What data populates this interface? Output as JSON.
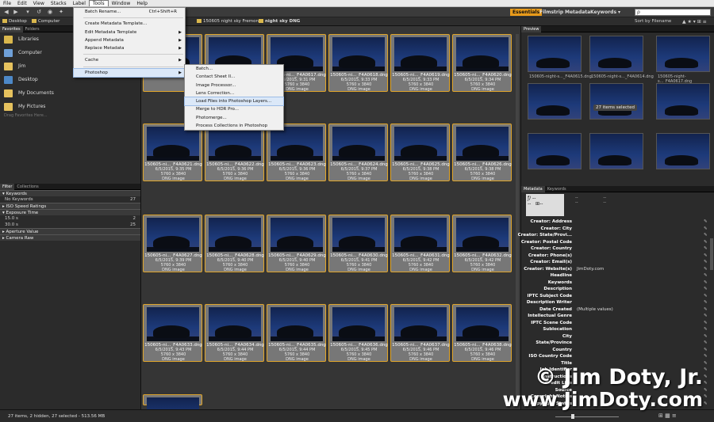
{
  "menubar": {
    "items": [
      "File",
      "Edit",
      "View",
      "Stacks",
      "Label",
      "Tools",
      "Window",
      "Help"
    ]
  },
  "toolbar": {
    "workspaces": [
      "Essentials",
      "Filmstrip",
      "Metadata",
      "Keywords"
    ],
    "search_placeholder": "ρ",
    "sort_label": "Sort by Filename"
  },
  "path": {
    "crumbs": [
      "Desktop",
      "Computer",
      "150605 night sky Fremont",
      "night sky DNG"
    ]
  },
  "tools_menu": {
    "items": [
      {
        "label": "Batch Rename...",
        "shortcut": "Ctrl+Shift+R"
      },
      {
        "label": "Create Metadata Template..."
      },
      {
        "label": "Edit Metadata Template",
        "submenu": true
      },
      {
        "label": "Append Metadata",
        "submenu": true
      },
      {
        "label": "Replace Metadata",
        "submenu": true
      },
      {
        "label": "Cache",
        "submenu": true
      },
      {
        "label": "Photoshop",
        "submenu": true
      }
    ]
  },
  "photoshop_submenu": {
    "items": [
      "Batch...",
      "Contact Sheet II...",
      "Image Processor...",
      "Lens Correction...",
      "Load Files into Photoshop Layers...",
      "Merge to HDR Pro...",
      "Photomerge...",
      "Process Collections in Photoshop"
    ]
  },
  "left_panel": {
    "tabs": [
      "Favorites",
      "Folders"
    ],
    "favorites": [
      "Libraries",
      "Computer",
      "Jim",
      "Desktop",
      "My Documents",
      "My Pictures"
    ],
    "drag_hint": "Drag Favorites Here...",
    "filter_tabs": [
      "Filter",
      "Collections"
    ],
    "filters": [
      {
        "header": "Keywords",
        "rows": [
          {
            "label": "No Keywords",
            "count": "27"
          }
        ]
      },
      {
        "header": "ISO Speed Ratings",
        "rows": []
      },
      {
        "header": "Exposure Time",
        "rows": [
          {
            "label": "15.0 s",
            "count": "2"
          },
          {
            "label": "30.0 s",
            "count": "25"
          }
        ]
      },
      {
        "header": "Aperture Value",
        "rows": []
      },
      {
        "header": "Camera Raw",
        "rows": []
      }
    ]
  },
  "thumbnails": [
    {
      "name": "150605-ni..._F4A0617.dng",
      "date": "6/5/2015, 9:31 PM",
      "dims": "5760 x 3840",
      "type": "DNG image"
    },
    {
      "name": "150605-ni..._F4A0618.dng",
      "date": "6/5/2015, 9:33 PM",
      "dims": "5760 x 3840",
      "type": "DNG image"
    },
    {
      "name": "150605-ni..._F4A0619.dng",
      "date": "6/5/2015, 9:33 PM",
      "dims": "5760 x 3840",
      "type": "DNG image"
    },
    {
      "name": "150605-ni..._F4A0620.dng",
      "date": "6/5/2015, 9:34 PM",
      "dims": "5760 x 3840",
      "type": "DNG image"
    },
    {
      "name": "150605-ni..._F4A0621.dng",
      "date": "6/5/2015, 9:35 PM",
      "dims": "5760 x 3840",
      "type": "DNG image"
    },
    {
      "name": "150605-ni..._F4A0622.dng",
      "date": "6/5/2015, 9:36 PM",
      "dims": "5760 x 3840",
      "type": "DNG image"
    },
    {
      "name": "150605-ni..._F4A0623.dng",
      "date": "6/5/2015, 9:36 PM",
      "dims": "5760 x 3840",
      "type": "DNG image"
    },
    {
      "name": "150605-ni..._F4A0624.dng",
      "date": "6/5/2015, 9:37 PM",
      "dims": "5760 x 3840",
      "type": "DNG image"
    },
    {
      "name": "150605-ni..._F4A0625.dng",
      "date": "6/5/2015, 9:38 PM",
      "dims": "5760 x 3840",
      "type": "DNG image"
    },
    {
      "name": "150605-ni..._F4A0626.dng",
      "date": "6/5/2015, 9:38 PM",
      "dims": "5760 x 3840",
      "type": "DNG image"
    },
    {
      "name": "150605-ni..._F4A0627.dng",
      "date": "6/5/2015, 9:39 PM",
      "dims": "5760 x 3840",
      "type": "DNG image"
    },
    {
      "name": "150605-ni..._F4A0628.dng",
      "date": "6/5/2015, 9:40 PM",
      "dims": "5760 x 3840",
      "type": "DNG image"
    },
    {
      "name": "150605-ni..._F4A0629.dng",
      "date": "6/5/2015, 9:40 PM",
      "dims": "5760 x 3840",
      "type": "DNG image"
    },
    {
      "name": "150605-ni..._F4A0630.dng",
      "date": "6/5/2015, 9:41 PM",
      "dims": "5760 x 3840",
      "type": "DNG image"
    },
    {
      "name": "150605-ni..._F4A0631.dng",
      "date": "6/5/2015, 9:42 PM",
      "dims": "5760 x 3840",
      "type": "DNG image"
    },
    {
      "name": "150605-ni..._F4A0632.dng",
      "date": "6/5/2015, 9:42 PM",
      "dims": "5760 x 3840",
      "type": "DNG image"
    },
    {
      "name": "150605-ni..._F4A0633.dng",
      "date": "6/5/2015, 9:43 PM",
      "dims": "5760 x 3840",
      "type": "DNG image"
    },
    {
      "name": "150605-ni..._F4A0634.dng",
      "date": "6/5/2015, 9:44 PM",
      "dims": "5760 x 3840",
      "type": "DNG image"
    },
    {
      "name": "150605-ni..._F4A0635.dng",
      "date": "6/5/2015, 9:44 PM",
      "dims": "5760 x 3840",
      "type": "DNG image"
    },
    {
      "name": "150605-ni..._F4A0636.dng",
      "date": "6/5/2015, 9:45 PM",
      "dims": "5760 x 3840",
      "type": "DNG image"
    },
    {
      "name": "150605-ni..._F4A0637.dng",
      "date": "6/5/2015, 9:46 PM",
      "dims": "5760 x 3840",
      "type": "DNG image"
    },
    {
      "name": "150605-ni..._F4A0638.dng",
      "date": "6/5/2015, 9:46 PM",
      "dims": "5760 x 3840",
      "type": "DNG image"
    }
  ],
  "preview": {
    "tab": "Preview",
    "captions": [
      "150605-night-s..._F4A0615.dng",
      "150605-night-s..._F4A0614.dng",
      "150605-night-s..._F4A0617.dng"
    ],
    "selected_badge": "27 items selected"
  },
  "metadata": {
    "tabs": [
      "Metadata",
      "Keywords"
    ],
    "fields": [
      {
        "label": "Creator: Address",
        "value": ""
      },
      {
        "label": "Creator: City",
        "value": ""
      },
      {
        "label": "Creator: State/Provi...",
        "value": ""
      },
      {
        "label": "Creator: Postal Code",
        "value": ""
      },
      {
        "label": "Creator: Country",
        "value": ""
      },
      {
        "label": "Creator: Phone(s)",
        "value": ""
      },
      {
        "label": "Creator: Email(s)",
        "value": ""
      },
      {
        "label": "Creator: Website(s)",
        "value": "JimDoty.com"
      },
      {
        "label": "Headline",
        "value": ""
      },
      {
        "label": "Keywords",
        "value": ""
      },
      {
        "label": "Description",
        "value": ""
      },
      {
        "label": "IPTC Subject Code",
        "value": ""
      },
      {
        "label": "Description Writer",
        "value": ""
      },
      {
        "label": "Date Created",
        "value": "(Multiple values)"
      },
      {
        "label": "Intellectual Genre",
        "value": ""
      },
      {
        "label": "IPTC Scene Code",
        "value": ""
      },
      {
        "label": "Sublocation",
        "value": ""
      },
      {
        "label": "City",
        "value": ""
      },
      {
        "label": "State/Province",
        "value": ""
      },
      {
        "label": "Country",
        "value": ""
      },
      {
        "label": "ISO Country Code",
        "value": ""
      },
      {
        "label": "Title",
        "value": ""
      },
      {
        "label": "Job Identifier",
        "value": ""
      },
      {
        "label": "Instructions",
        "value": ""
      },
      {
        "label": "Credit Line",
        "value": ""
      },
      {
        "label": "Source",
        "value": ""
      },
      {
        "label": "Copyright Notice",
        "value": ""
      },
      {
        "label": "Copyright Status",
        "value": ""
      }
    ]
  },
  "status": {
    "text": "27 items, 2 hidden, 27 selected - 513.56 MB"
  },
  "watermark": {
    "line1": "© Jim Doty, Jr.",
    "line2": "www.JimDoty.com"
  },
  "colors": {
    "accent": "#e89a1a",
    "selection_border": "#e0a52a"
  }
}
